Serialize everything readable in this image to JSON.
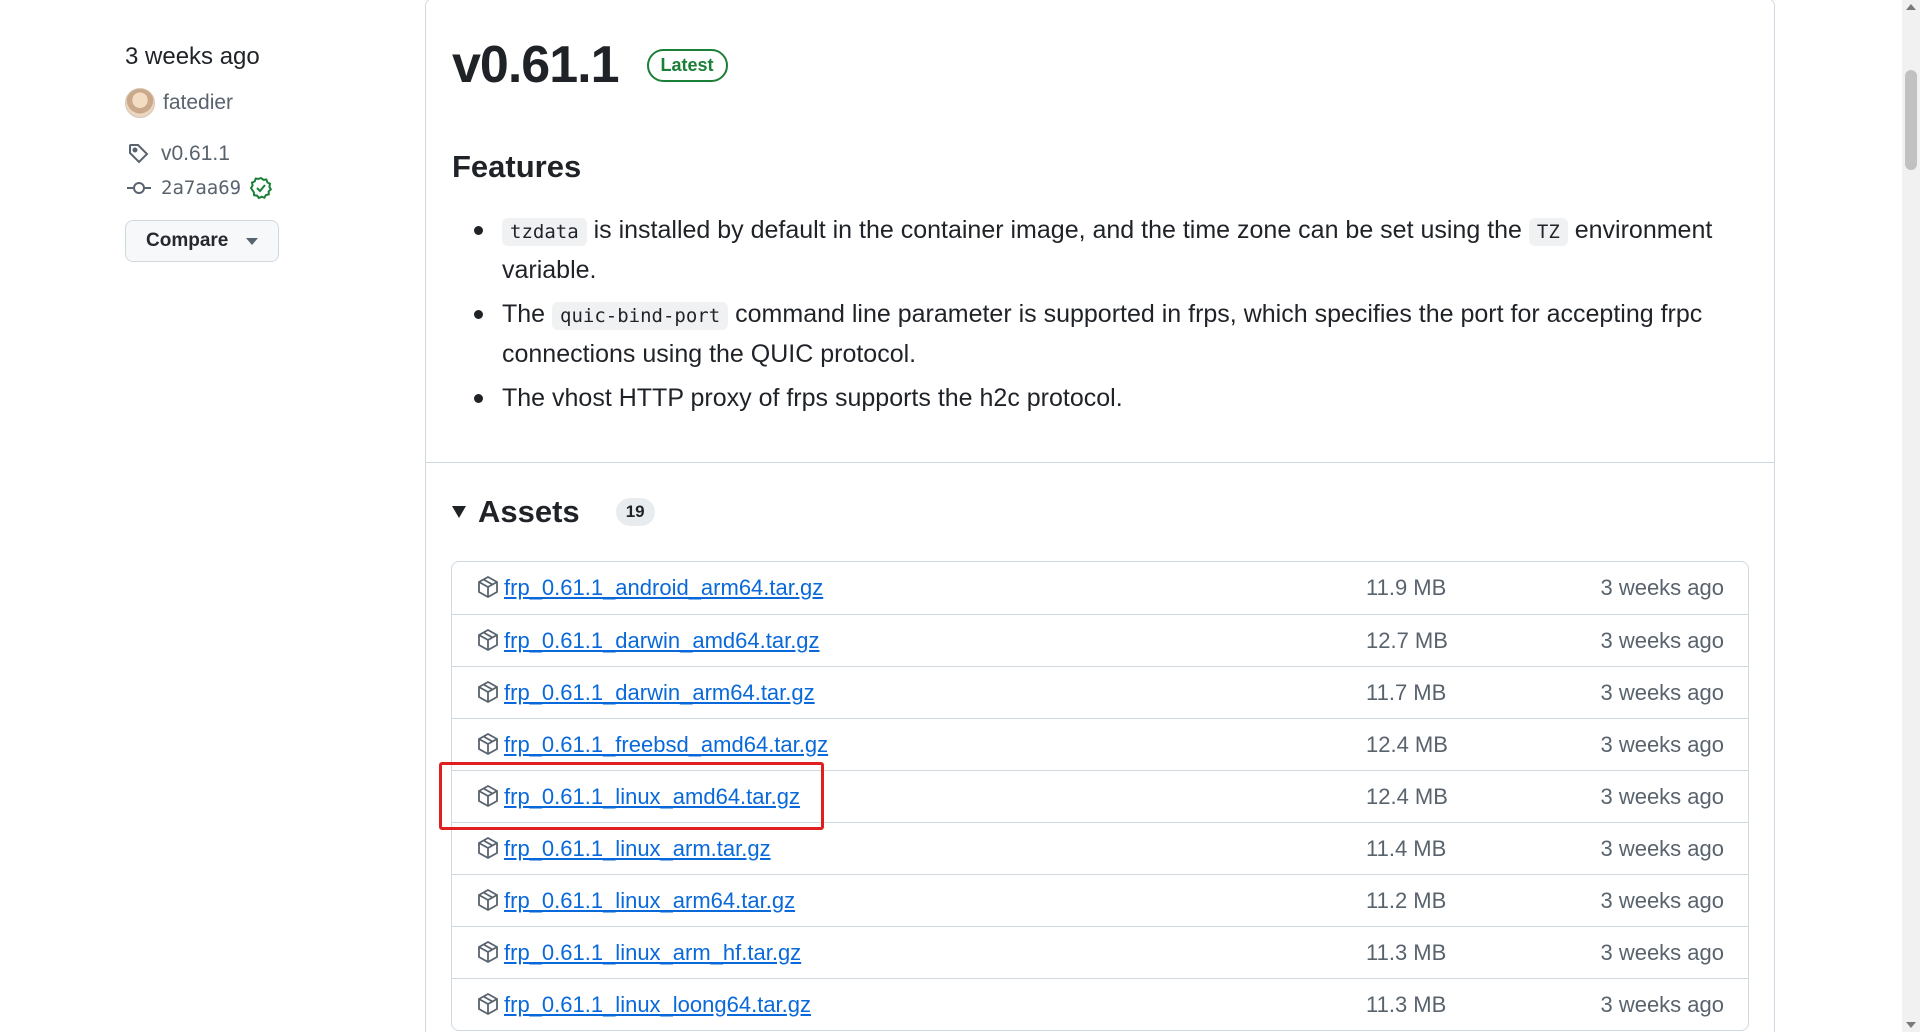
{
  "sidebar": {
    "time": "3 weeks ago",
    "author": "fatedier",
    "tag": "v0.61.1",
    "commit": "2a7aa69",
    "compare_label": "Compare"
  },
  "release": {
    "title": "v0.61.1",
    "badge": "Latest"
  },
  "features": {
    "heading": "Features",
    "items": [
      {
        "code1": "tzdata",
        "text1": " is installed by default in the container image, and the time zone can be set using the ",
        "code2": "TZ",
        "text2": " environment variable."
      },
      {
        "pre": "The ",
        "code1": "quic-bind-port",
        "text1": " command line parameter is supported in frps, which specifies the port for accepting frpc connections using the QUIC protocol."
      },
      {
        "text": "The vhost HTTP proxy of frps supports the h2c protocol."
      }
    ]
  },
  "assets": {
    "heading": "Assets",
    "count": "19",
    "rows": [
      {
        "name": "frp_0.61.1_android_arm64.tar.gz",
        "size": "11.9 MB",
        "date": "3 weeks ago"
      },
      {
        "name": "frp_0.61.1_darwin_amd64.tar.gz",
        "size": "12.7 MB",
        "date": "3 weeks ago"
      },
      {
        "name": "frp_0.61.1_darwin_arm64.tar.gz",
        "size": "11.7 MB",
        "date": "3 weeks ago"
      },
      {
        "name": "frp_0.61.1_freebsd_amd64.tar.gz",
        "size": "12.4 MB",
        "date": "3 weeks ago"
      },
      {
        "name": "frp_0.61.1_linux_amd64.tar.gz",
        "size": "12.4 MB",
        "date": "3 weeks ago"
      },
      {
        "name": "frp_0.61.1_linux_arm.tar.gz",
        "size": "11.4 MB",
        "date": "3 weeks ago"
      },
      {
        "name": "frp_0.61.1_linux_arm64.tar.gz",
        "size": "11.2 MB",
        "date": "3 weeks ago"
      },
      {
        "name": "frp_0.61.1_linux_arm_hf.tar.gz",
        "size": "11.3 MB",
        "date": "3 weeks ago"
      },
      {
        "name": "frp_0.61.1_linux_loong64.tar.gz",
        "size": "11.3 MB",
        "date": "3 weeks ago"
      }
    ]
  },
  "colors": {
    "link": "#0969da",
    "latest_green": "#1a7f37",
    "highlight_red": "#e02020"
  },
  "icons": {
    "tag": "tag-icon",
    "commit": "git-commit-icon",
    "verified": "verified-check-icon",
    "package": "package-icon"
  }
}
